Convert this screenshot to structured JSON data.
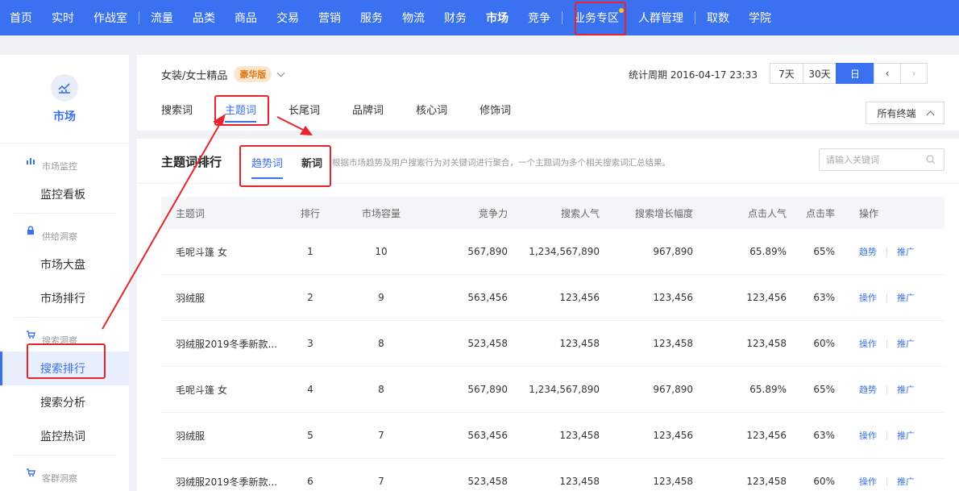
{
  "topnav": {
    "items": [
      "首页",
      "实时",
      "作战室",
      "流量",
      "品类",
      "商品",
      "交易",
      "营销",
      "服务",
      "物流",
      "财务",
      "市场",
      "竞争",
      "业务专区",
      "人群管理",
      "取数",
      "学院"
    ]
  },
  "sidebar": {
    "title": "市场",
    "groups": [
      {
        "label": "市场监控",
        "items": [
          "监控看板"
        ]
      },
      {
        "label": "供给洞察",
        "items": [
          "市场大盘",
          "市场排行"
        ]
      },
      {
        "label": "搜索洞察",
        "items": [
          "搜索排行",
          "搜索分析",
          "监控热词"
        ]
      },
      {
        "label": "客群洞察",
        "items": []
      }
    ]
  },
  "header": {
    "category": "女装/女士精品",
    "badge": "豪华版",
    "period": "统计周期 2016-04-17 23:33",
    "period_buttons": [
      "7天",
      "30天",
      "日"
    ],
    "tabs": [
      "搜索词",
      "主题词",
      "长尾词",
      "品牌词",
      "核心词",
      "修饰词"
    ],
    "terminal": "所有终端"
  },
  "panel": {
    "title": "主题词排行",
    "subtabs": [
      "趋势词",
      "新词"
    ],
    "desc": "根据市场趋势及用户搜索行为对关键词进行聚合，一个主题词为多个相关搜索词汇总结果。",
    "search_placeholder": "请输入关键词"
  },
  "table": {
    "headers": [
      "主题词",
      "排行",
      "市场容量",
      "竞争力",
      "搜索人气",
      "搜索增长幅度",
      "点击人气",
      "点击率",
      "操作"
    ],
    "rows": [
      {
        "name": "毛呢斗篷 女",
        "rank": "1",
        "cap": "10",
        "comp": "567,890",
        "hot": "1,234,567,890",
        "grow": "967,890",
        "click": "65.89%",
        "ctr": "65%",
        "op1": "趋势",
        "op2": "推广"
      },
      {
        "name": "羽绒服",
        "rank": "2",
        "cap": "9",
        "comp": "563,456",
        "hot": "123,456",
        "grow": "123,456",
        "click": "123,456",
        "ctr": "63%",
        "op1": "操作",
        "op2": "推广"
      },
      {
        "name": "羽绒服2019冬季新款...",
        "rank": "3",
        "cap": "8",
        "comp": "523,458",
        "hot": "123,458",
        "grow": "123,458",
        "click": "123,458",
        "ctr": "60%",
        "op1": "操作",
        "op2": "推广"
      },
      {
        "name": "毛呢斗篷 女",
        "rank": "4",
        "cap": "8",
        "comp": "567,890",
        "hot": "1,234,567,890",
        "grow": "967,890",
        "click": "65.89%",
        "ctr": "65%",
        "op1": "趋势",
        "op2": "推广"
      },
      {
        "name": "羽绒服",
        "rank": "5",
        "cap": "7",
        "comp": "563,456",
        "hot": "123,458",
        "grow": "123,456",
        "click": "123,456",
        "ctr": "63%",
        "op1": "操作",
        "op2": "推广"
      },
      {
        "name": "羽绒服2019冬季新款...",
        "rank": "6",
        "cap": "7",
        "comp": "523,458",
        "hot": "123,458",
        "grow": "123,458",
        "click": "123,458",
        "ctr": "60%",
        "op1": "操作",
        "op2": "推广"
      }
    ]
  },
  "colors": {
    "accent": "#3a71f0",
    "highlight": "#e8232b",
    "badge": "#e07a14"
  }
}
